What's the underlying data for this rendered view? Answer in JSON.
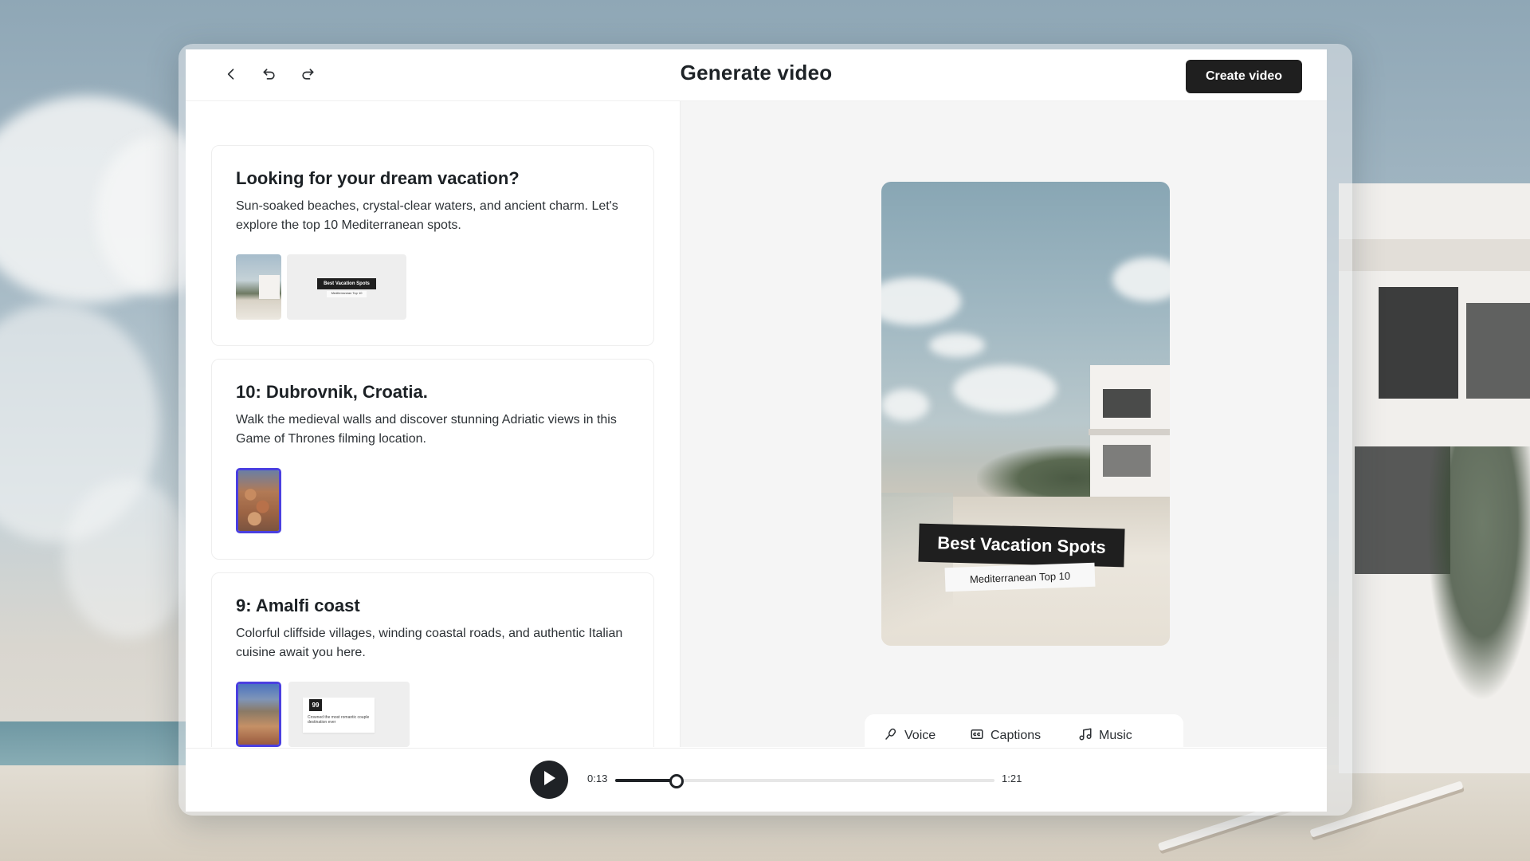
{
  "header": {
    "title": "Generate video",
    "create_label": "Create video",
    "icons": [
      "chevron-left-icon",
      "undo-icon",
      "redo-icon"
    ]
  },
  "scenes": [
    {
      "title": "Looking for your dream vacation?",
      "text": "Sun-soaked beaches, crystal-clear waters, and ancient charm. Let's explore the top 10 Mediterranean spots.",
      "slide_title": "Best Vacation Spots",
      "slide_subtitle": "Mediterranean Top 10"
    },
    {
      "title": "10: Dubrovnik, Croatia.",
      "text": "Walk the medieval walls and discover stunning Adriatic views in this Game of Thrones filming location."
    },
    {
      "title": "9: Amalfi coast",
      "text": "Colorful cliffside villages, winding coastal roads, and authentic Italian cuisine await you here.",
      "quote_mark": "99",
      "quote_text": "Crowned the most romantic couple destination ever"
    }
  ],
  "preview": {
    "title_card": "Best Vacation Spots",
    "subtitle_card": "Mediterranean Top 10"
  },
  "tools": [
    {
      "label": "Voice",
      "icon": "microphone-icon"
    },
    {
      "label": "Captions",
      "icon": "captions-icon"
    },
    {
      "label": "Music",
      "icon": "music-note-icon"
    }
  ],
  "player": {
    "current_time": "0:13",
    "duration": "1:21",
    "progress": 0.16
  },
  "colors": {
    "accent_dark": "#1f1f1f",
    "selection": "#4a3fe0"
  }
}
